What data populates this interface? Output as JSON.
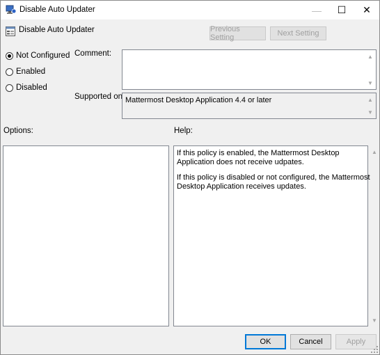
{
  "window": {
    "title": "Disable Auto Updater",
    "controls": {
      "minimize": "—",
      "maximize": "☐",
      "close": "✕"
    }
  },
  "policy": {
    "name": "Disable Auto Updater",
    "previous_setting": "Previous Setting",
    "next_setting": "Next Setting"
  },
  "state": {
    "options": [
      {
        "label": "Not Configured",
        "selected": true
      },
      {
        "label": "Enabled",
        "selected": false
      },
      {
        "label": "Disabled",
        "selected": false
      }
    ]
  },
  "comment": {
    "label": "Comment:",
    "value": ""
  },
  "supported": {
    "label": "Supported on:",
    "value": "Mattermost Desktop Application 4.4 or later"
  },
  "options_panel": {
    "label": "Options:"
  },
  "help_panel": {
    "label": "Help:",
    "paragraphs": [
      "If this policy is enabled, the Mattermost Desktop Application does not receive udpates.",
      "If this policy is disabled or not configured, the Mattermost Desktop Application receives updates."
    ]
  },
  "buttons": {
    "ok": "OK",
    "cancel": "Cancel",
    "apply": "Apply"
  },
  "icons": [
    "app-icon",
    "policy-setting-icon",
    "scroll-up-icon",
    "scroll-down-icon",
    "size-grip-icon"
  ]
}
